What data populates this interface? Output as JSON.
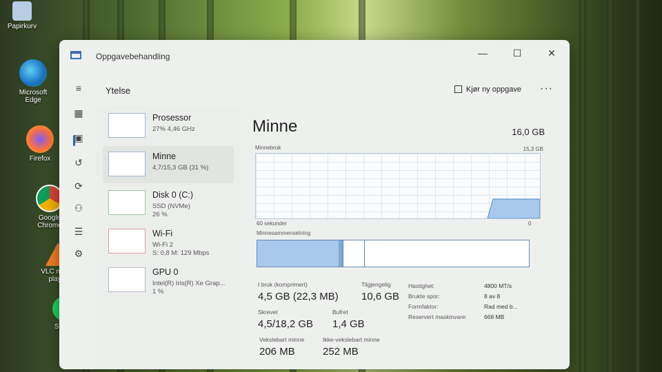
{
  "desktop": {
    "icons": [
      {
        "label": "Papirkurv",
        "icon": "recycle-bin-icon"
      },
      {
        "label": "Microsoft Edge",
        "icon": "edge-icon"
      },
      {
        "label": "Firefox",
        "icon": "firefox-icon"
      },
      {
        "label": "Google Chrome",
        "icon": "chrome-icon"
      },
      {
        "label": "VLC media player",
        "icon": "vlc-icon"
      },
      {
        "label": "Spotify",
        "icon": "spotify-icon"
      }
    ]
  },
  "window": {
    "title": "Oppgavebehandling",
    "controls": {
      "minimize": "—",
      "maximize": "☐",
      "close": "✕"
    }
  },
  "header": {
    "section_title": "Ytelse",
    "run_new_task": "Kjør ny oppgave",
    "more": "···"
  },
  "perf_list": [
    {
      "name": "Prosessor",
      "sub1": "27% 4,46 GHz",
      "sub2": ""
    },
    {
      "name": "Minne",
      "sub1": "4,7/15,3 GB (31 %)",
      "sub2": ""
    },
    {
      "name": "Disk 0 (C:)",
      "sub1": "SSD (NVMe)",
      "sub2": "26 %"
    },
    {
      "name": "Wi-Fi",
      "sub1": "Wi-Fi 2",
      "sub2": "S: 0,8 M: 129 Mbps"
    },
    {
      "name": "GPU 0",
      "sub1": "Intel(R) Iris(R) Xe Grap...",
      "sub2": "1 %"
    }
  ],
  "memory": {
    "title": "Minne",
    "total": "16,0 GB",
    "usage_label": "Minnebruk",
    "usage_max": "15,3 GB",
    "time_label": "60 sekunder",
    "time_zero": "0",
    "composition_label": "Minnesammensetning",
    "in_use_fraction": 0.31,
    "stats": {
      "in_use_label": "I bruk (komprimert)",
      "in_use_value": "4,5 GB (22,3 MB)",
      "available_label": "Tilgjengelig",
      "available_value": "10,6 GB",
      "committed_label": "Skrevet",
      "committed_value": "4,5/18,2 GB",
      "cached_label": "Bufret",
      "cached_value": "1,4 GB",
      "paged_label": "Vekslebart minne",
      "paged_value": "206 MB",
      "nonpaged_label": "Ikke-vekslebart minne",
      "nonpaged_value": "252 MB"
    },
    "details": [
      {
        "k": "Hastighet:",
        "v": "4800 MT/s"
      },
      {
        "k": "Brukte spor:",
        "v": "8 av 8"
      },
      {
        "k": "Formfaktor:",
        "v": "Rad med b..."
      },
      {
        "k": "Reservert maskinvare:",
        "v": "668 MB"
      }
    ]
  },
  "colors": {
    "accent": "#2c67b8",
    "fill": "#a9c9ec",
    "border": "#6a8ab4"
  }
}
